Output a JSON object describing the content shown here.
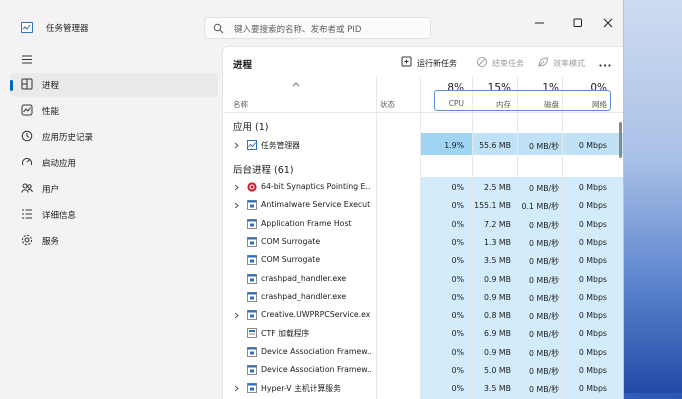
{
  "app": {
    "title": "任务管理器"
  },
  "search": {
    "placeholder": "键入要搜索的名称、发布者或 PID"
  },
  "window_buttons": [
    {
      "name": "minimize-button",
      "icon": "minimize-icon"
    },
    {
      "name": "maximize-button",
      "icon": "maximize-icon"
    },
    {
      "name": "close-button",
      "icon": "close-icon"
    }
  ],
  "sidebar": {
    "items": [
      {
        "label": "进程",
        "icon": "processes-icon",
        "active": true
      },
      {
        "label": "性能",
        "icon": "performance-icon",
        "active": false
      },
      {
        "label": "应用历史记录",
        "icon": "app-history-icon",
        "active": false
      },
      {
        "label": "启动应用",
        "icon": "startup-apps-icon",
        "active": false
      },
      {
        "label": "用户",
        "icon": "users-icon",
        "active": false
      },
      {
        "label": "详细信息",
        "icon": "details-icon",
        "active": false
      },
      {
        "label": "服务",
        "icon": "services-icon",
        "active": false
      }
    ]
  },
  "main": {
    "title": "进程",
    "toolbar": {
      "run_new_task": "运行新任务",
      "end_task": "结束任务",
      "efficiency_mode": "效率模式"
    },
    "columns": {
      "name": "名称",
      "status": "状态",
      "cpu": "CPU",
      "memory": "内存",
      "disk": "磁盘",
      "network": "网络"
    },
    "usage": {
      "cpu": "8%",
      "memory": "15%",
      "disk": "1%",
      "network": "0%"
    },
    "groups": {
      "apps": "应用 (1)",
      "background": "后台进程 (61)"
    },
    "apps": [
      {
        "name": "任务管理器",
        "expandable": true,
        "icon": "task-manager-icon",
        "cpu": "1.9%",
        "memory": "55.6 MB",
        "disk": "0 MB/秒",
        "network": "0 Mbps"
      }
    ],
    "background": [
      {
        "name": "64-bit Synaptics Pointing E...",
        "expandable": true,
        "icon": "synaptics-icon",
        "cpu": "0%",
        "memory": "2.5 MB",
        "disk": "0 MB/秒",
        "network": "0 Mbps"
      },
      {
        "name": "Antimalware Service Execut...",
        "expandable": true,
        "icon": "process-icon",
        "cpu": "0%",
        "memory": "155.1 MB",
        "disk": "0.1 MB/秒",
        "network": "0 Mbps"
      },
      {
        "name": "Application Frame Host",
        "expandable": false,
        "icon": "process-icon",
        "cpu": "0%",
        "memory": "7.2 MB",
        "disk": "0 MB/秒",
        "network": "0 Mbps"
      },
      {
        "name": "COM Surrogate",
        "expandable": false,
        "icon": "process-icon",
        "cpu": "0%",
        "memory": "1.3 MB",
        "disk": "0 MB/秒",
        "network": "0 Mbps"
      },
      {
        "name": "COM Surrogate",
        "expandable": false,
        "icon": "process-icon",
        "cpu": "0%",
        "memory": "3.5 MB",
        "disk": "0 MB/秒",
        "network": "0 Mbps"
      },
      {
        "name": "crashpad_handler.exe",
        "expandable": false,
        "icon": "process-icon",
        "cpu": "0%",
        "memory": "0.9 MB",
        "disk": "0 MB/秒",
        "network": "0 Mbps"
      },
      {
        "name": "crashpad_handler.exe",
        "expandable": false,
        "icon": "process-icon",
        "cpu": "0%",
        "memory": "0.9 MB",
        "disk": "0 MB/秒",
        "network": "0 Mbps"
      },
      {
        "name": "Creative.UWPRPCService.ex...",
        "expandable": true,
        "icon": "process-icon",
        "cpu": "0%",
        "memory": "0.8 MB",
        "disk": "0 MB/秒",
        "network": "0 Mbps"
      },
      {
        "name": "CTF 加载程序",
        "expandable": false,
        "icon": "ctf-icon",
        "cpu": "0%",
        "memory": "6.9 MB",
        "disk": "0 MB/秒",
        "network": "0 Mbps"
      },
      {
        "name": "Device Association Framew...",
        "expandable": false,
        "icon": "process-icon",
        "cpu": "0%",
        "memory": "0.9 MB",
        "disk": "0 MB/秒",
        "network": "0 Mbps"
      },
      {
        "name": "Device Association Framew...",
        "expandable": false,
        "icon": "process-icon",
        "cpu": "0%",
        "memory": "5.0 MB",
        "disk": "0 MB/秒",
        "network": "0 Mbps"
      },
      {
        "name": "Hyper-V 主机计算服务",
        "expandable": true,
        "icon": "process-icon",
        "cpu": "0%",
        "memory": "3.5 MB",
        "disk": "0 MB/秒",
        "network": "0 Mbps"
      }
    ]
  },
  "colors": {
    "accent": "#0067c0",
    "heat_light": "#d3ecfb",
    "heat_medium": "#bfe2f7",
    "heat_cpu_hot": "#9fd4f3",
    "highlight_box": "#5b8fd3"
  }
}
